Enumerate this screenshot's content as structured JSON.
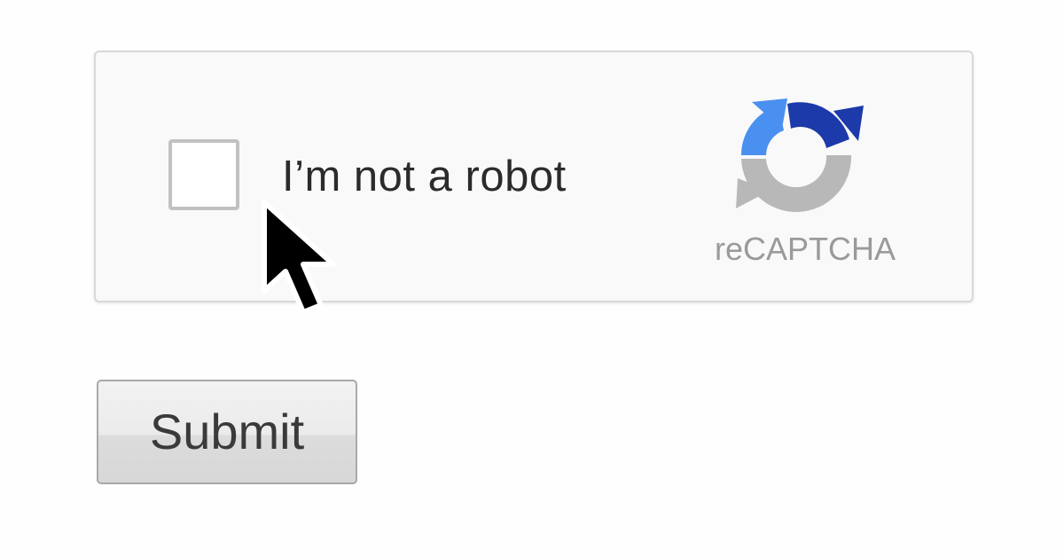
{
  "captcha": {
    "label": "I’m not a robot",
    "checked": false,
    "brand": "reCAPTCHA",
    "logo_icon": "recaptcha-logo-icon",
    "logo_colors": {
      "blue_light": "#4a90f0",
      "blue_dark": "#1c3aa9",
      "gray": "#b8b8b8"
    }
  },
  "cursor": {
    "icon": "mouse-pointer-arrow-icon"
  },
  "form": {
    "submit_label": "Submit"
  }
}
